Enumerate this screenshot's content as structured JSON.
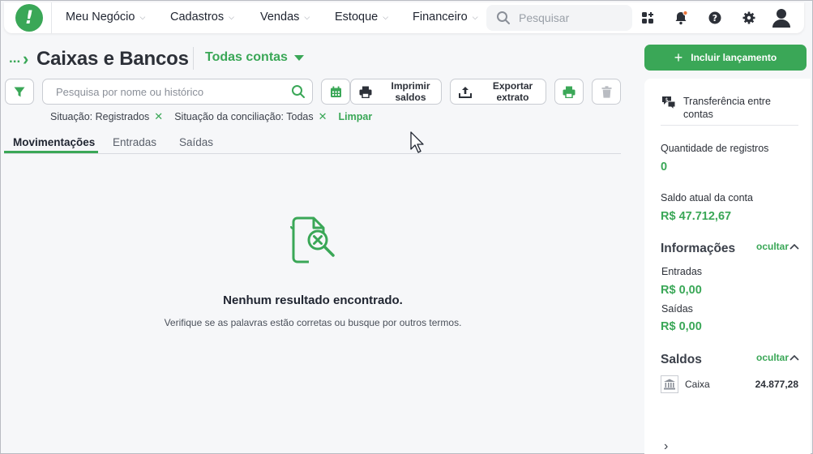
{
  "topbar": {
    "logo_text": "!",
    "nav": [
      {
        "label": "Meu Negócio"
      },
      {
        "label": "Cadastros"
      },
      {
        "label": "Vendas"
      },
      {
        "label": "Estoque"
      },
      {
        "label": "Financeiro"
      }
    ],
    "search_placeholder": "Pesquisar",
    "icons": [
      "apps-icon",
      "bell-icon",
      "help-icon",
      "gear-icon",
      "user-avatar-icon"
    ],
    "notification_dot_color": "#e8743b"
  },
  "header": {
    "breadcrumb_dots": "...",
    "title": "Caixas e Bancos",
    "account_select": "Todas contas"
  },
  "toolbar": {
    "search_placeholder": "Pesquisa por nome ou histórico",
    "print_saldos_label": "Imprimir saldos",
    "export_label": "Exportar extrato"
  },
  "filters": {
    "chips": [
      {
        "label": "Situação: Registrados"
      },
      {
        "label": "Situação da conciliação: Todas"
      }
    ],
    "clear_label": "Limpar"
  },
  "tabs": [
    {
      "label": "Movimentações",
      "active": true
    },
    {
      "label": "Entradas",
      "active": false
    },
    {
      "label": "Saídas",
      "active": false
    }
  ],
  "empty_state": {
    "title": "Nenhum resultado encontrado.",
    "subtitle": "Verifique se as palavras estão corretas ou busque por outros termos."
  },
  "sidebar": {
    "add_button": "Incluir lançamento",
    "transfer_label": "Transferência entre contas",
    "records_label": "Quantidade de registros",
    "records_value": "0",
    "balance_label": "Saldo atual da conta",
    "balance_value": "R$ 47.712,67",
    "info_title": "Informações",
    "info_hide": "ocultar",
    "entradas_label": "Entradas",
    "entradas_value": "R$ 0,00",
    "saidas_label": "Saídas",
    "saidas_value": "R$ 0,00",
    "saldos_title": "Saldos",
    "saldos_hide": "ocultar",
    "saldos": [
      {
        "name": "Caixa",
        "amount": "24.877,28"
      }
    ]
  },
  "colors": {
    "accent": "#3aa757",
    "text": "#1f2430",
    "background": "#f6f7f9"
  }
}
